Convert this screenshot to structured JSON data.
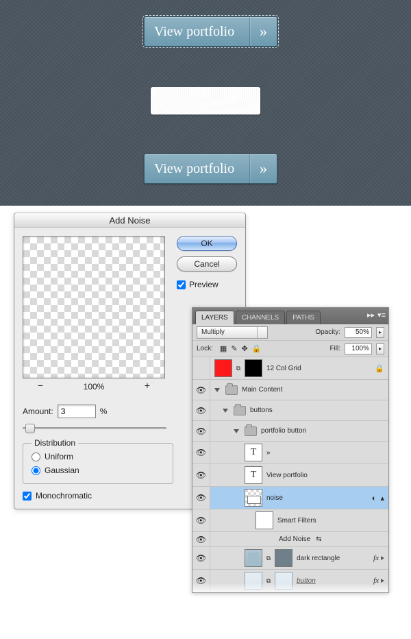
{
  "canvas": {
    "button1_label": "View portfolio",
    "button2_label": "View portfolio",
    "chevrons": "»"
  },
  "dialog": {
    "title": "Add Noise",
    "ok": "OK",
    "cancel": "Cancel",
    "preview": "Preview",
    "zoom_minus": "−",
    "zoom_value": "100%",
    "zoom_plus": "+",
    "amount_label": "Amount:",
    "amount_value": "3",
    "amount_unit": "%",
    "distribution_legend": "Distribution",
    "uniform": "Uniform",
    "gaussian": "Gaussian",
    "monochromatic": "Monochromatic"
  },
  "layers": {
    "tabs": {
      "layers": "LAYERS",
      "channels": "CHANNELS",
      "paths": "PATHS"
    },
    "blend_mode": "Multiply",
    "opacity_label": "Opacity:",
    "opacity_value": "50%",
    "lock_label": "Lock:",
    "fill_label": "Fill:",
    "fill_value": "100%",
    "items": {
      "grid": "12 Col Grid",
      "main": "Main Content",
      "buttons": "buttons",
      "portfolio": "portfolio button",
      "chev": "»",
      "viewportfolio": "View portfolio",
      "noise": "noise",
      "smartfilters": "Smart Filters",
      "addnoise": "Add Noise",
      "darkrect": "dark rectangle",
      "button": "button",
      "fx": "fx"
    }
  }
}
